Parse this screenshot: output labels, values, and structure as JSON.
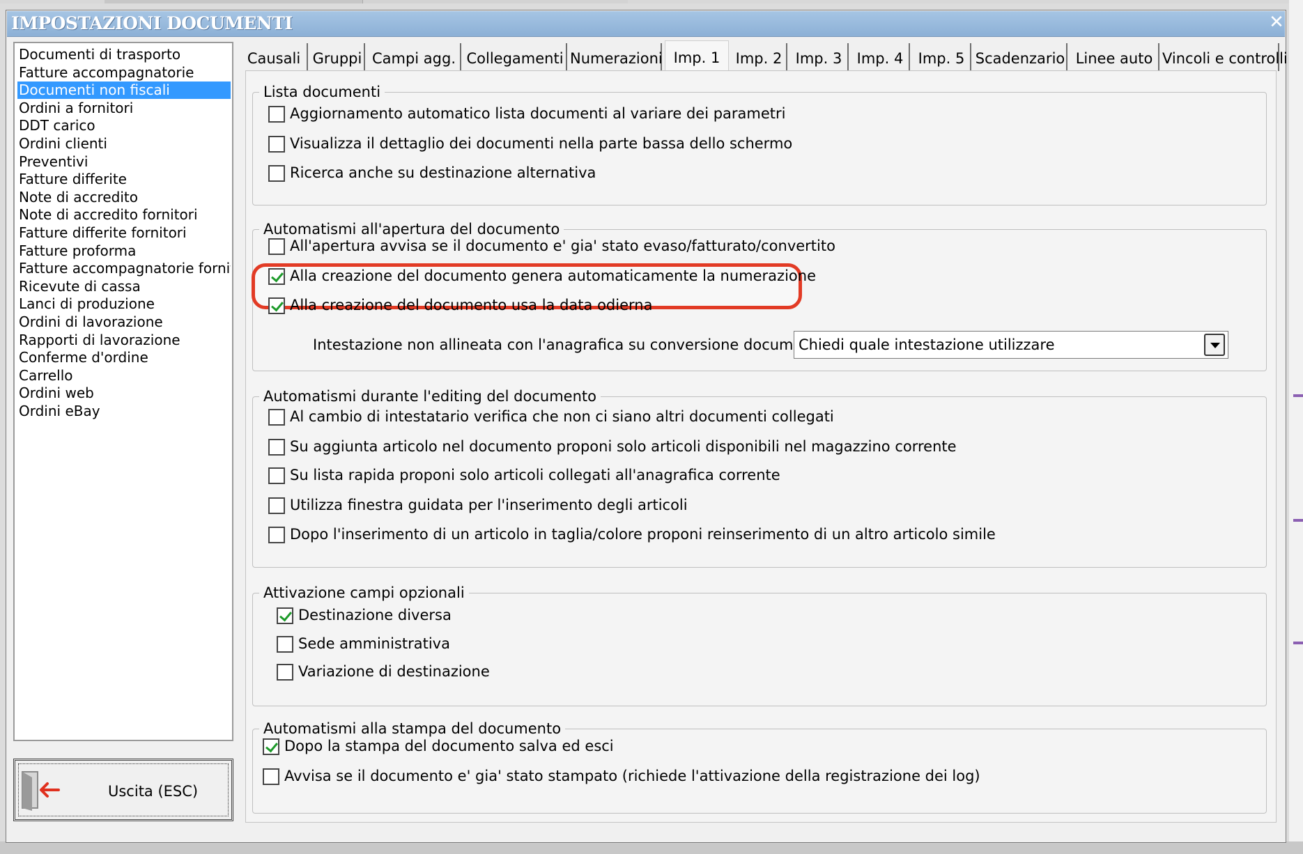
{
  "window": {
    "title": "IMPOSTAZIONI DOCUMENTI"
  },
  "doc_list": [
    "Documenti di trasporto",
    "Fatture accompagnatorie",
    "Documenti non fiscali",
    "Ordini a fornitori",
    "DDT carico",
    "Ordini clienti",
    "Preventivi",
    "Fatture differite",
    "Note di accredito",
    "Note di accredito fornitori",
    "Fatture differite fornitori",
    "Fatture proforma",
    "Fatture accompagnatorie fornito",
    "Ricevute di cassa",
    "Lanci di produzione",
    "Ordini di lavorazione",
    "Rapporti di lavorazione",
    "Conferme d'ordine",
    "Carrello",
    "Ordini web",
    "Ordini eBay"
  ],
  "doc_list_selected": "Documenti non fiscali",
  "exit_button": {
    "label": "Uscita (ESC)"
  },
  "tabs": [
    "Causali",
    "Gruppi",
    "Campi agg.",
    "Collegamenti",
    "Numerazioni",
    "Imp. 1",
    "Imp. 2",
    "Imp. 3",
    "Imp. 4",
    "Imp. 5",
    "Scadenzario",
    "Linee auto",
    "Vincoli e controlli"
  ],
  "active_tab": "Imp. 1",
  "groups": {
    "lista": {
      "title": "Lista documenti",
      "options": [
        {
          "label": "Aggiornamento automatico lista documenti al variare dei parametri",
          "checked": false
        },
        {
          "label": "Visualizza il dettaglio dei documenti nella parte bassa dello schermo",
          "checked": false
        },
        {
          "label": "Ricerca anche su destinazione alternativa",
          "checked": false
        }
      ]
    },
    "apertura": {
      "title": "Automatismi all'apertura del documento",
      "options": [
        {
          "label": "All'apertura avvisa se il documento e' gia' stato evaso/fatturato/convertito",
          "checked": false
        },
        {
          "label": "Alla creazione del documento genera automaticamente la numerazione",
          "checked": true
        },
        {
          "label": "Alla creazione del documento usa la data odierna",
          "checked": true
        }
      ],
      "combo_label": "Intestazione non allineata con l'anagrafica su conversione documento :",
      "combo_value": "Chiedi quale intestazione utilizzare"
    },
    "editing": {
      "title": "Automatismi durante l'editing del documento",
      "options": [
        {
          "label": "Al cambio di intestatario verifica che non ci siano altri documenti collegati",
          "checked": false
        },
        {
          "label": "Su aggiunta articolo nel documento proponi solo articoli disponibili nel magazzino corrente",
          "checked": false
        },
        {
          "label": "Su lista rapida proponi solo articoli collegati all'anagrafica corrente",
          "checked": false
        },
        {
          "label": "Utilizza finestra guidata per l'inserimento degli articoli",
          "checked": false
        },
        {
          "label": "Dopo l'inserimento di un articolo in taglia/colore proponi reinserimento di un altro articolo simile",
          "checked": false
        }
      ]
    },
    "campi": {
      "title": "Attivazione campi opzionali",
      "options": [
        {
          "label": "Destinazione diversa",
          "checked": true
        },
        {
          "label": "Sede amministrativa",
          "checked": false
        },
        {
          "label": "Variazione di destinazione",
          "checked": false
        }
      ]
    },
    "stampa": {
      "title": "Automatismi alla stampa del documento",
      "options": [
        {
          "label": "Dopo la stampa del documento salva ed esci",
          "checked": true
        },
        {
          "label": "Avvisa se il documento e' gia' stato stampato (richiede l'attivazione della registrazione dei log)",
          "checked": false
        }
      ]
    }
  },
  "colors": {
    "titlebar": "#8cb0d6",
    "selection": "#3399ff",
    "highlight": "#e23b25",
    "check": "#1d9a2a"
  }
}
